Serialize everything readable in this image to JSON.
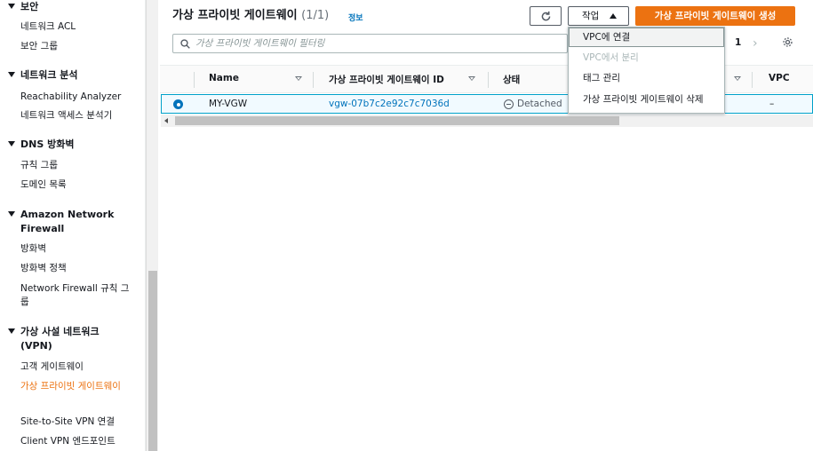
{
  "sidebar": {
    "sections": [
      {
        "title": "보안",
        "items": [
          "네트워크 ACL",
          "보안 그룹"
        ]
      },
      {
        "title": "네트워크 분석",
        "items": [
          "Reachability Analyzer",
          "네트워크 액세스 분석기"
        ]
      },
      {
        "title": "DNS 방화벽",
        "items": [
          "규칙 그룹",
          "도메인 목록"
        ]
      },
      {
        "title": "Amazon Network Firewall",
        "items": [
          "방화벽",
          "방화벽 정책",
          "Network Firewall 규칙 그룹"
        ]
      },
      {
        "title": "가상 사설 네트워크 (VPN)",
        "items": [
          "고객 게이트웨이",
          "가상 프라이빗 게이트웨이",
          "Site-to-Site VPN 연결",
          "Client VPN 엔드포인트"
        ]
      }
    ],
    "active_item": "가상 프라이빗 게이트웨이"
  },
  "header": {
    "title": "가상 프라이빗 게이트웨이",
    "count": "(1/1)",
    "info_link": "정보",
    "actions_label": "작업",
    "create_label": "가상 프라이빗 게이트웨이 생성"
  },
  "search": {
    "placeholder": "가상 프라이빗 게이트웨이 필터링"
  },
  "pagination": {
    "page": "1"
  },
  "table": {
    "columns": [
      "Name",
      "가상 프라이빗 게이트웨이 ID",
      "상태",
      "VPC"
    ],
    "rows": [
      {
        "name": "MY-VGW",
        "id": "vgw-07b7c2e92c7c7036d",
        "status": "Detached",
        "vpc": "–",
        "selected": true
      }
    ]
  },
  "actions_menu": {
    "items": [
      {
        "label": "VPC에 연결",
        "disabled": false
      },
      {
        "label": "VPC에서 분리",
        "disabled": true
      },
      {
        "label": "태그 관리",
        "disabled": false
      },
      {
        "label": "가상 프라이빗 게이트웨이 삭제",
        "disabled": false
      }
    ]
  },
  "colors": {
    "accent": "#ec7211",
    "link": "#0073bb",
    "selected_row": "#f1faff"
  }
}
